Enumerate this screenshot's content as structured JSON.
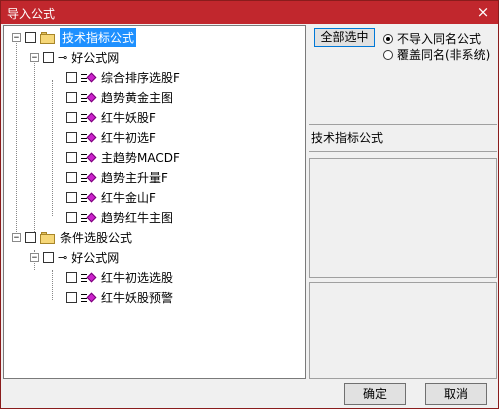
{
  "window": {
    "title": "导入公式",
    "close_icon": "×"
  },
  "tree": {
    "groups": [
      {
        "label": "技术指标公式",
        "selected": true,
        "expand_symbol": "−",
        "subfolder": {
          "label": "好公式网",
          "expand_symbol": "−",
          "items": [
            "综合排序选股F",
            "趋势黄金主图",
            "红牛妖股F",
            "红牛初选F",
            "主趋势MACDF",
            "趋势主升量F",
            "红牛金山F",
            "趋势红牛主图"
          ]
        }
      },
      {
        "label": "条件选股公式",
        "selected": false,
        "expand_symbol": "−",
        "subfolder": {
          "label": "好公式网",
          "expand_symbol": "−",
          "items": [
            "红牛初选选股",
            "红牛妖股预警"
          ]
        }
      }
    ]
  },
  "options": {
    "select_all_label": "全部选中",
    "radio_options": [
      {
        "label": "不导入同名公式",
        "checked": true
      },
      {
        "label": "覆盖同名(非系统)",
        "checked": false
      }
    ]
  },
  "info": {
    "section_label": "技术指标公式"
  },
  "footer": {
    "ok_label": "确定",
    "cancel_label": "取消"
  }
}
